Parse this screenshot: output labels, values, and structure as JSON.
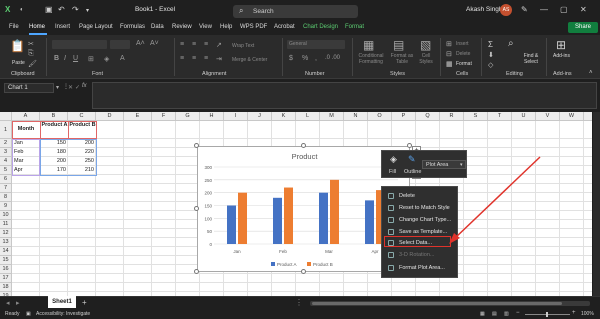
{
  "titlebar": {
    "doc_title": "Book1 - Excel",
    "search_placeholder": "Search",
    "user_name": "Akash Singh",
    "avatar_initials": "AS"
  },
  "menu": {
    "tabs": [
      "File",
      "Home",
      "Insert",
      "Page Layout",
      "Formulas",
      "Data",
      "Review",
      "View",
      "Help",
      "WPS PDF",
      "Acrobat",
      "Chart Design",
      "Format"
    ],
    "share": "Share"
  },
  "ribbon": {
    "clipboard": "Clipboard",
    "paste": "Paste",
    "font": "Font",
    "alignment": "Alignment",
    "wrap_text": "Wrap Text",
    "merge_center": "Merge & Center",
    "number": "Number",
    "number_format": "General",
    "styles": "Styles",
    "conditional_formatting": "Conditional Formatting",
    "format_as_table": "Format as Table",
    "cell_styles": "Cell Styles",
    "cells": "Cells",
    "insert": "Insert",
    "delete": "Delete",
    "format": "Format",
    "editing": "Editing",
    "find_select": "Find & Select",
    "addins": "Add-ins",
    "addins_btn": "Add-ins"
  },
  "formula_bar": {
    "name_box": "Chart 1",
    "cancel": "✕",
    "enter": "✓",
    "fx": "fx"
  },
  "grid": {
    "columns": [
      "A",
      "B",
      "C",
      "D",
      "E",
      "F",
      "G",
      "H",
      "I",
      "J",
      "K",
      "L",
      "M",
      "N",
      "O",
      "P",
      "Q",
      "R",
      "S",
      "T",
      "U",
      "V",
      "W",
      "X"
    ],
    "rows": [
      "1",
      "2",
      "3",
      "4",
      "5",
      "6",
      "7",
      "8",
      "9",
      "10",
      "11",
      "12",
      "13",
      "14",
      "15",
      "16",
      "17",
      "18",
      "19",
      "20"
    ],
    "header_month": "Month",
    "header_a": "Product A",
    "header_b": "Product B",
    "data": [
      {
        "month": "Jan",
        "a": "150",
        "b": "200"
      },
      {
        "month": "Feb",
        "a": "180",
        "b": "220"
      },
      {
        "month": "Mar",
        "a": "200",
        "b": "250"
      },
      {
        "month": "Apr",
        "a": "170",
        "b": "210"
      }
    ]
  },
  "chart_data": {
    "type": "bar",
    "title": "Product",
    "categories": [
      "Jan",
      "Feb",
      "Mar",
      "Apr"
    ],
    "series": [
      {
        "name": "Product A",
        "values": [
          150,
          180,
          200,
          170
        ],
        "color": "#4472c4"
      },
      {
        "name": "Product B",
        "values": [
          200,
          220,
          250,
          210
        ],
        "color": "#ed7d31"
      }
    ],
    "ylim": [
      0,
      300
    ],
    "yticks": [
      "0",
      "50",
      "100",
      "150",
      "200",
      "250",
      "300"
    ],
    "grid": true,
    "legend": "bottom"
  },
  "mini_toolbar": {
    "fill": "Fill",
    "outline": "Outline",
    "element": "Plot Area"
  },
  "context_menu": {
    "items": [
      {
        "label": "Delete",
        "enabled": true
      },
      {
        "label": "Reset to Match Style",
        "enabled": true
      },
      {
        "label": "Change Chart Type...",
        "enabled": true
      },
      {
        "label": "Save as Template...",
        "enabled": true
      },
      {
        "label": "Select Data...",
        "enabled": true
      },
      {
        "label": "3-D Rotation...",
        "enabled": false
      },
      {
        "label": "Format Plot Area...",
        "enabled": true
      }
    ]
  },
  "sheets": {
    "active": "Sheet1",
    "add": "+"
  },
  "status": {
    "ready": "Ready",
    "accessibility": "Accessibility: Investigate",
    "zoom": "100%"
  },
  "colors": {
    "accent_green": "#117e3e",
    "highlight_red": "#e0332b",
    "series_a": "#4472c4",
    "series_b": "#ed7d31"
  }
}
